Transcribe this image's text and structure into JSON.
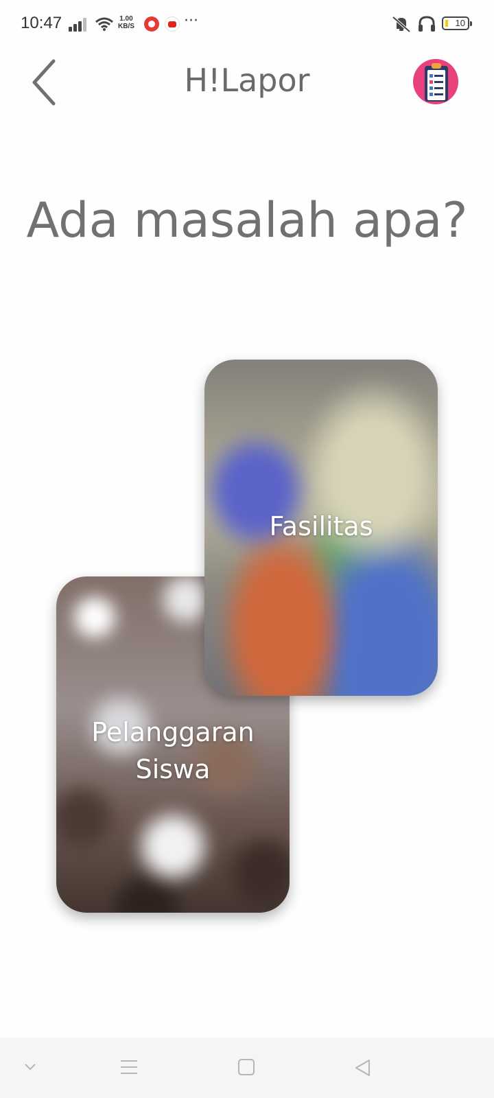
{
  "status_bar": {
    "time": "10:47",
    "speed_top": "1.00",
    "speed_unit": "KB/S",
    "more": "···",
    "battery": "10"
  },
  "header": {
    "title": "H!Lapor",
    "back_icon": "chevron-left-icon",
    "report_icon": "clipboard-checklist-icon"
  },
  "main": {
    "question": "Ada masalah apa?",
    "cards": [
      {
        "label": "Fasilitas",
        "image": "classroom-photo"
      },
      {
        "label": "Pelanggaran Siswa",
        "image": "students-crowd-photo"
      }
    ]
  },
  "nav_bar": {
    "items": [
      "collapse-icon",
      "menu-icon",
      "home-icon",
      "back-icon"
    ]
  },
  "colors": {
    "title": "#6a6a6a",
    "accent_pink": "#e9417c",
    "background": "#fefefe"
  }
}
